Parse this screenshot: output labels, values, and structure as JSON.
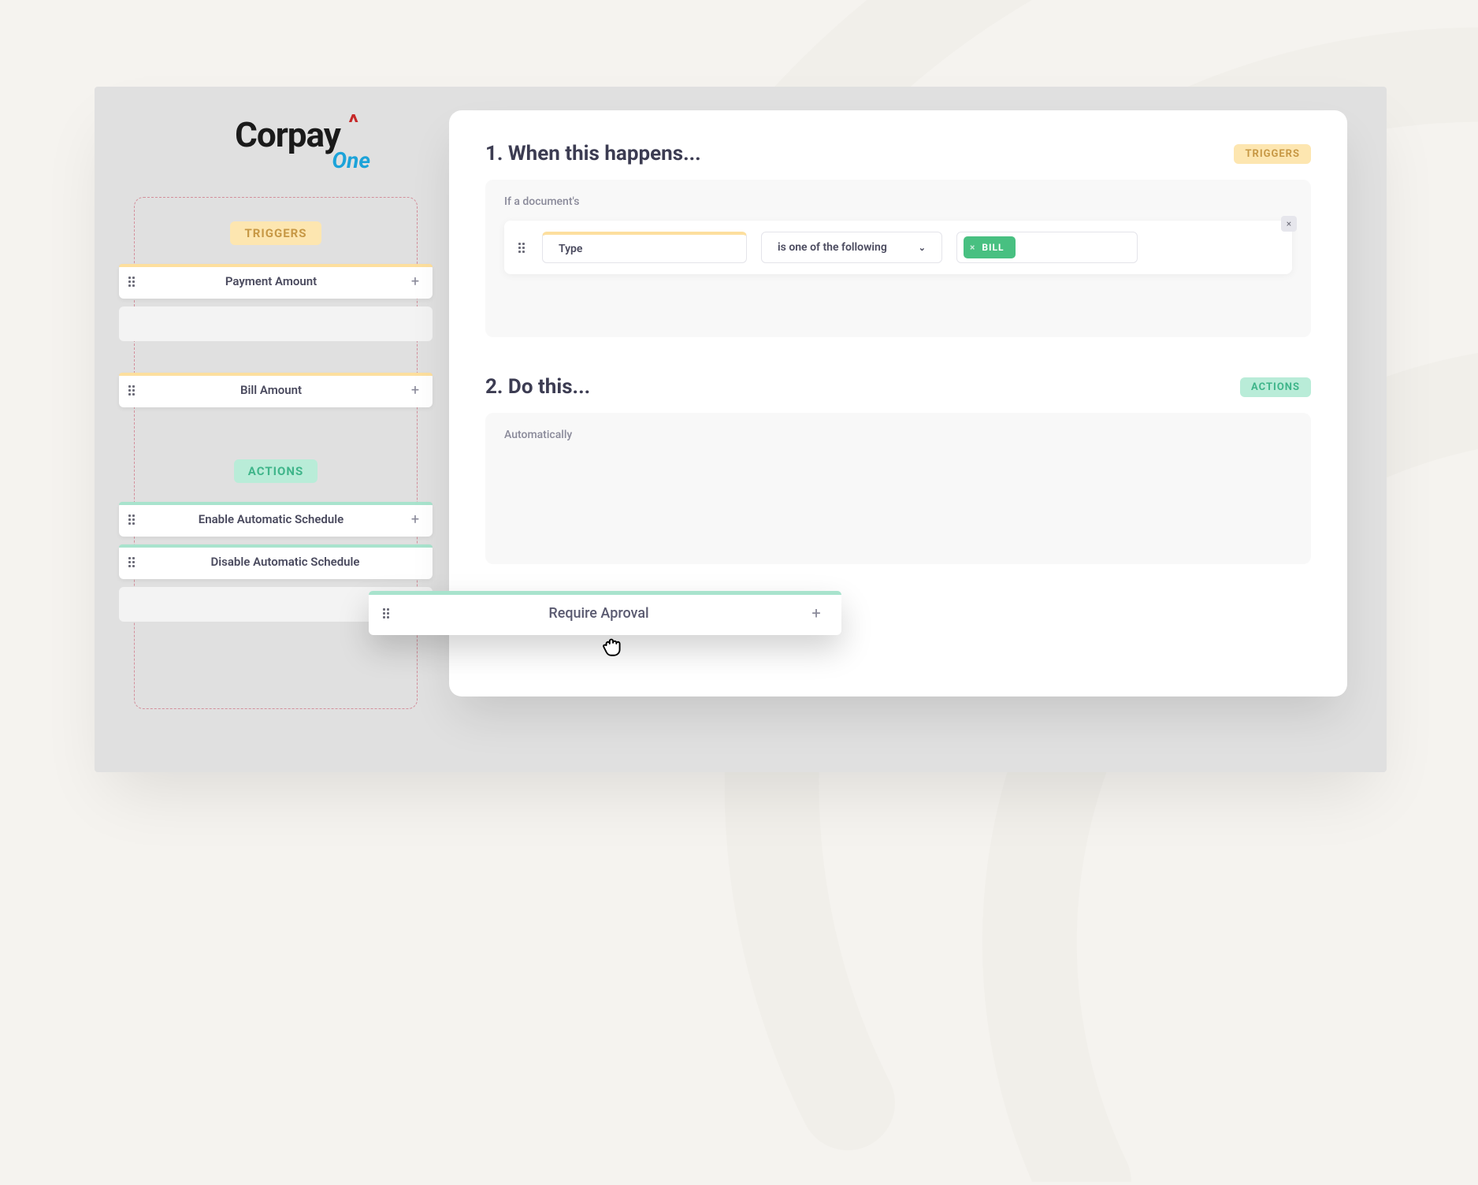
{
  "logo": {
    "main": "Corpay",
    "sub": "One"
  },
  "sidebar": {
    "triggers_label": "TRIGGERS",
    "actions_label": "ACTIONS",
    "triggers": [
      {
        "label": "Payment Amount"
      },
      {
        "label": "Bill Amount"
      }
    ],
    "actions": [
      {
        "label": "Enable Automatic Schedule"
      },
      {
        "label": "Disable Automatic Schedule"
      }
    ]
  },
  "main": {
    "section1": {
      "title": "1. When this happens...",
      "badge": "TRIGGERS",
      "hint": "If a document's",
      "condition": {
        "field": "Type",
        "operator": "is one of the following",
        "value": "BILL"
      }
    },
    "section2": {
      "title": "2. Do this...",
      "badge": "ACTIONS",
      "hint": "Automatically"
    }
  },
  "floating": {
    "label": "Require Aproval"
  }
}
